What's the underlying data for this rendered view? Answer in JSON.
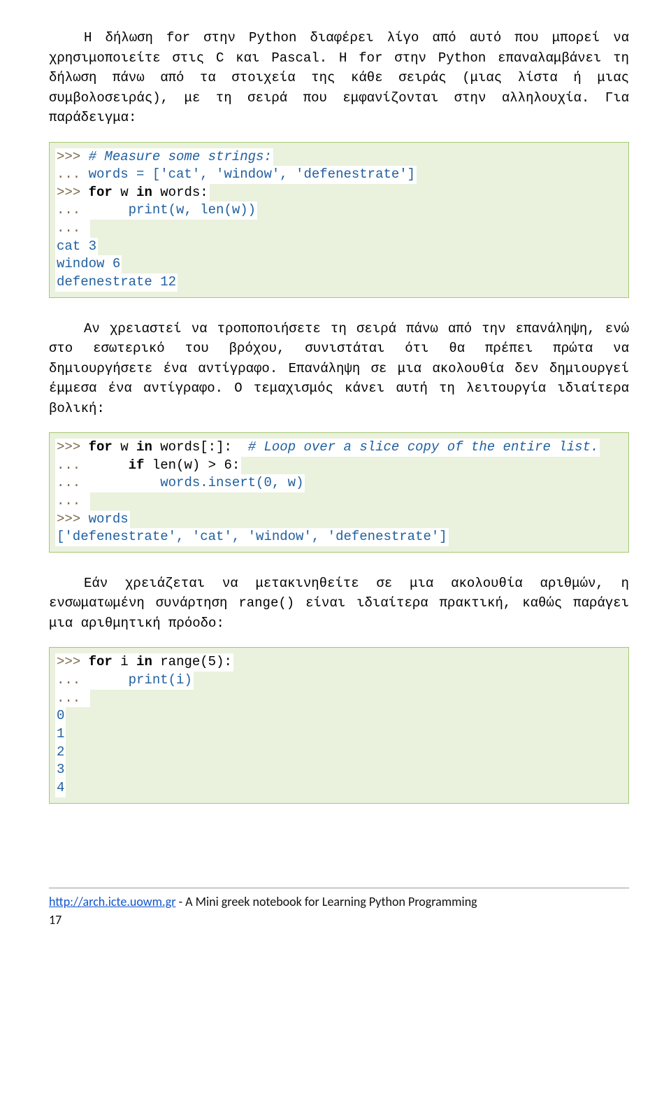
{
  "paragraphs": {
    "p1": "Η δήλωση for στην Python διαφέρει λίγο από αυτό που μπορεί να χρησιμοποιείτε στις C και Pascal. Η for στην Python επαναλαμβάνει τη δήλωση πάνω από τα στοιχεία της κάθε σειράς (μιας λίστα ή μιας συμβολοσειράς), με τη σειρά που εμφανίζονται στην αλληλουχία. Για παράδειγμα:",
    "p2": "Αν χρειαστεί να τροποποιήσετε τη σειρά πάνω από την επανάληψη, ενώ στο εσωτερικό του βρόχου, συνιστάται ότι θα πρέπει πρώτα να δημιουργήσετε ένα αντίγραφο. Επανάληψη σε μια ακολουθία δεν δημιουργεί έμμεσα ένα αντίγραφο. Ο τεμαχισμός κάνει αυτή τη λειτουργία ιδιαίτερα βολική:",
    "p3": "Εάν χρειάζεται να μετακινηθείτε σε μια ακολουθία αριθμών, η ενσωματωμένη συνάρτηση range() είναι ιδιαίτερα πρακτική, καθώς παράγει μια αριθμητική πρόοδο:"
  },
  "code1": {
    "l1_prompt": ">>> ",
    "l1_comment": "# Measure some strings:",
    "l2_cont": "... ",
    "l2_text": "words = ['cat', 'window', 'defenestrate']",
    "l3_prompt": ">>> ",
    "l3_kw1": "for",
    "l3_mid": " w ",
    "l3_kw2": "in",
    "l3_rest": " words:",
    "l4_cont": "...      ",
    "l4_text": "print(w, len(w))",
    "l5_cont": "... ",
    "l6": "cat 3",
    "l7": "window 6",
    "l8": "defenestrate 12"
  },
  "code2": {
    "l1_prompt": ">>> ",
    "l1_kw1": "for",
    "l1_mid": " w ",
    "l1_kw2": "in",
    "l1_rest": " words[:]:  ",
    "l1_comment": "# Loop over a slice copy of the entire list.",
    "l2_cont": "...      ",
    "l2_kw": "if",
    "l2_rest": " len(w) > 6:",
    "l3_cont": "...          ",
    "l3_text": "words.insert(0, w)",
    "l4_cont": "... ",
    "l5_prompt": ">>> ",
    "l5_text": "words",
    "l6": "['defenestrate', 'cat', 'window', 'defenestrate']"
  },
  "code3": {
    "l1_prompt": ">>> ",
    "l1_kw1": "for",
    "l1_mid": " i ",
    "l1_kw2": "in",
    "l1_rest": " range(5):",
    "l2_cont": "...      ",
    "l2_text": "print(i)",
    "l3_cont": "... ",
    "l4": "0",
    "l5": "1",
    "l6": "2",
    "l7": "3",
    "l8": "4"
  },
  "footer": {
    "link": "http://arch.icte.uowm.gr",
    "tail": " - A Mini greek notebook for Learning Python Programming",
    "page": "17"
  }
}
